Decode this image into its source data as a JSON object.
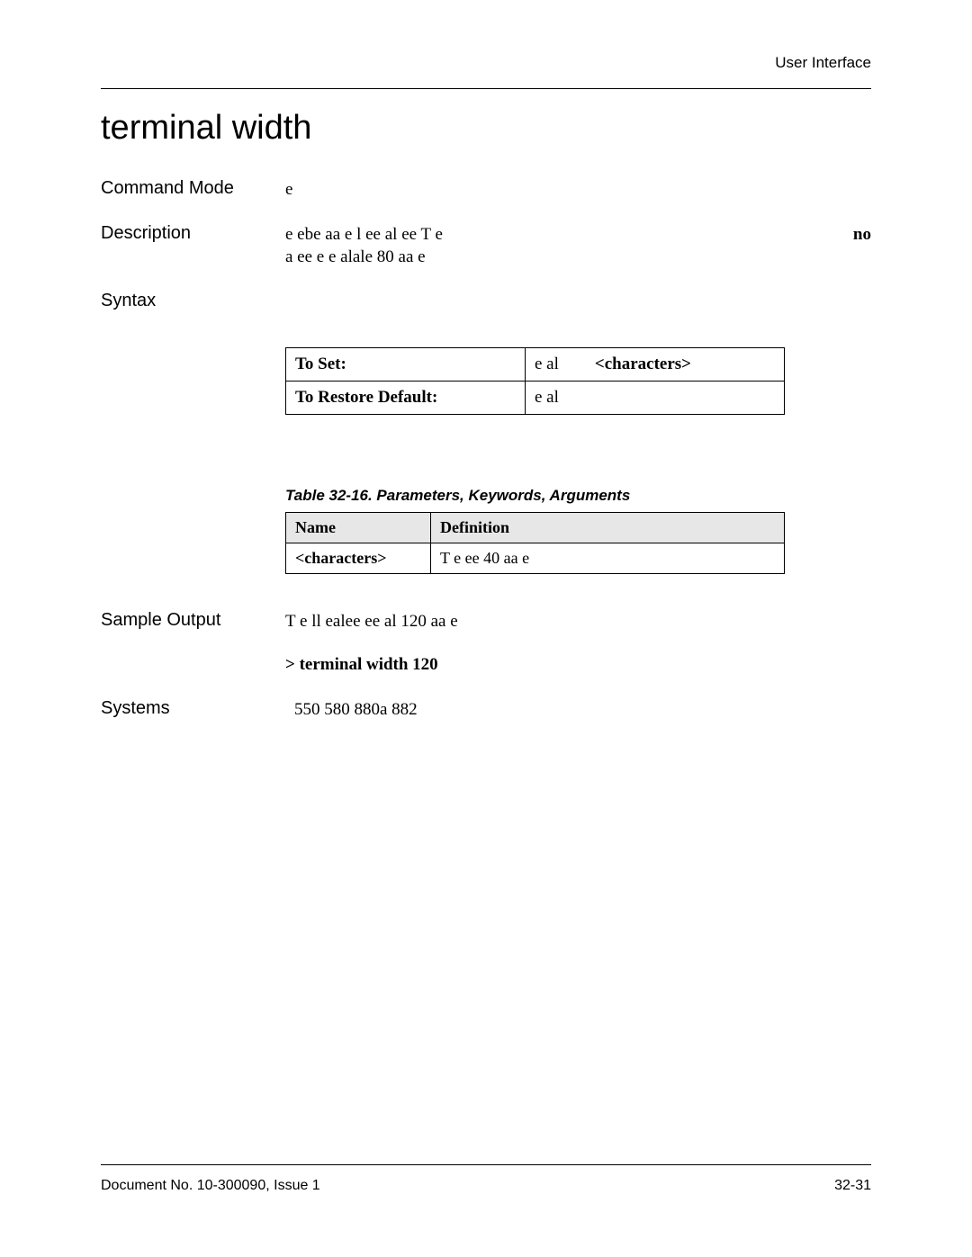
{
  "header": {
    "section": "User Interface"
  },
  "title": "terminal width",
  "commandMode": {
    "label": "Command Mode",
    "value": "e"
  },
  "description": {
    "label": "Description",
    "line1": "e  ebe   aa e l  ee al  ee T e",
    "bold": "no",
    "line2": "a  ee  e  e alale 80   aa e"
  },
  "syntax": {
    "label": "Syntax",
    "rows": [
      {
        "label": "To Set:",
        "cmd": "e  al",
        "arg": "<characters>"
      },
      {
        "label": "To Restore Default:",
        "cmd": "e  al",
        "arg": ""
      }
    ]
  },
  "paramTable": {
    "caption": "Table 32-16.  Parameters, Keywords, Arguments",
    "headers": [
      "Name",
      "Definition"
    ],
    "rows": [
      {
        "name": "<characters>",
        "definition": "T  e  ee    40   aa e"
      }
    ]
  },
  "sampleOutput": {
    "label": "Sample Output",
    "text": "T  e ll  ealee  ee al    120   aa e",
    "cmd": "> terminal width 120"
  },
  "systems": {
    "label": "Systems",
    "value": "550   580  880a   882"
  },
  "footer": {
    "left": "Document No. 10-300090, Issue 1",
    "right": "32-31"
  }
}
